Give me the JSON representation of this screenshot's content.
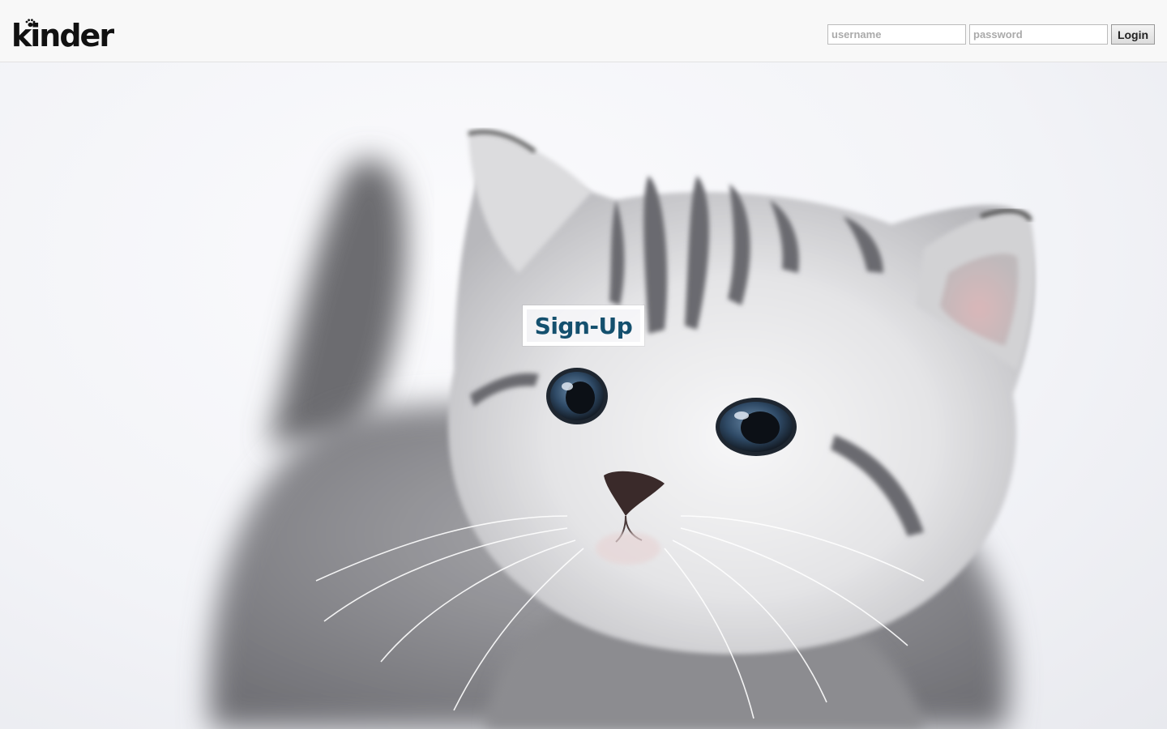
{
  "brand": {
    "name": "kinder",
    "paw_icon": "paw-icon"
  },
  "login": {
    "username_placeholder": "username",
    "password_placeholder": "password",
    "button_label": "Login"
  },
  "hero": {
    "image": "kitten-photo",
    "signup_label": "Sign-Up"
  },
  "colors": {
    "header_bg": "#f8f8f8",
    "signup_text": "#14506e",
    "logo": "#111111"
  }
}
